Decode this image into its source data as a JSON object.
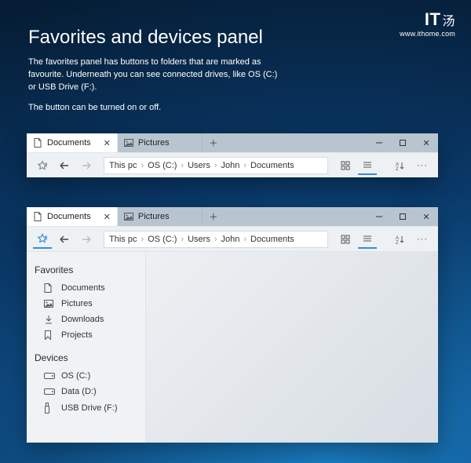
{
  "watermark": {
    "logo": "IT",
    "glyph": "汤",
    "url": "www.ithome.com"
  },
  "heading": "Favorites and devices panel",
  "paragraph1": "The favorites panel has buttons to folders that are marked as favourite. Underneath you can see connected drives, like OS (C:) or USB Drive (F:).",
  "paragraph2": "The button can be turned on or off.",
  "tabs": {
    "tab1": "Documents",
    "tab2": "Pictures"
  },
  "breadcrumb": {
    "a": "This pc",
    "b": "OS (C:)",
    "c": "Users",
    "d": "John",
    "e": "Documents"
  },
  "sidebar": {
    "fav_title": "Favorites",
    "documents": "Documents",
    "pictures": "Pictures",
    "downloads": "Downloads",
    "projects": "Projects",
    "dev_title": "Devices",
    "os": "OS (C:)",
    "data": "Data (D:)",
    "usb": "USB Drive (F:)"
  }
}
